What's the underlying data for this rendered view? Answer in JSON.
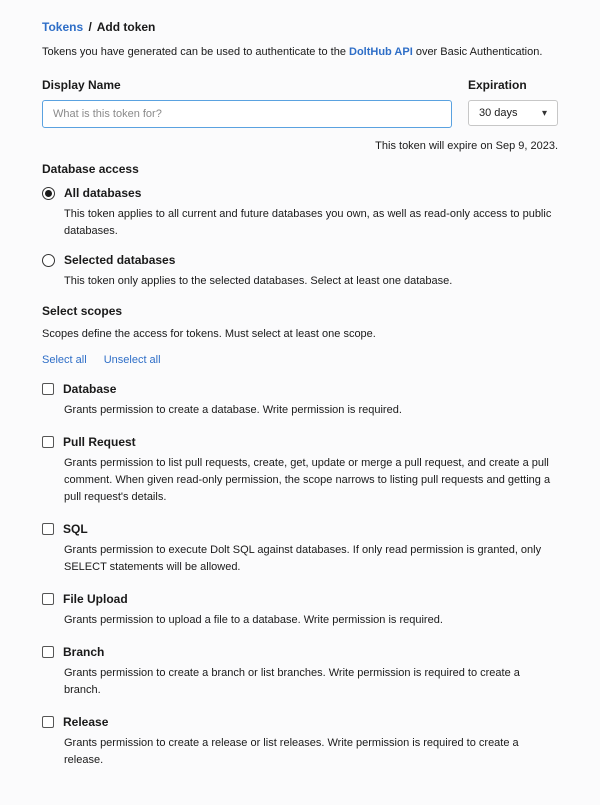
{
  "breadcrumb": {
    "parent": "Tokens",
    "sep": "/",
    "current": "Add token"
  },
  "intro": {
    "prefix": "Tokens you have generated can be used to authenticate to the ",
    "link": "DoltHub API",
    "suffix": " over Basic Authentication."
  },
  "display_name": {
    "label": "Display Name",
    "placeholder": "What is this token for?"
  },
  "expiration": {
    "label": "Expiration",
    "selected": "30 days",
    "note": "This token will expire on Sep 9, 2023."
  },
  "db_access": {
    "header": "Database access",
    "all": {
      "label": "All databases",
      "desc": "This token applies to all current and future databases you own, as well as read-only access to public databases."
    },
    "selected_opt": {
      "label": "Selected databases",
      "desc": "This token only applies to the selected databases. Select at least one database."
    }
  },
  "scopes": {
    "header": "Select scopes",
    "intro": "Scopes define the access for tokens. Must select at least one scope.",
    "select_all": "Select all",
    "unselect_all": "Unselect all",
    "items": [
      {
        "title": "Database",
        "desc": "Grants permission to create a database. Write permission is required."
      },
      {
        "title": "Pull Request",
        "desc": "Grants permission to list pull requests, create, get, update or merge a pull request, and create a pull comment. When given read-only permission, the scope narrows to listing pull requests and getting a pull request's details."
      },
      {
        "title": "SQL",
        "desc": "Grants permission to execute Dolt SQL against databases. If only read permission is granted, only SELECT statements will be allowed."
      },
      {
        "title": "File Upload",
        "desc": "Grants permission to upload a file to a database. Write permission is required."
      },
      {
        "title": "Branch",
        "desc": "Grants permission to create a branch or list branches. Write permission is required to create a branch."
      },
      {
        "title": "Release",
        "desc": "Grants permission to create a release or list releases. Write permission is required to create a release."
      }
    ]
  }
}
